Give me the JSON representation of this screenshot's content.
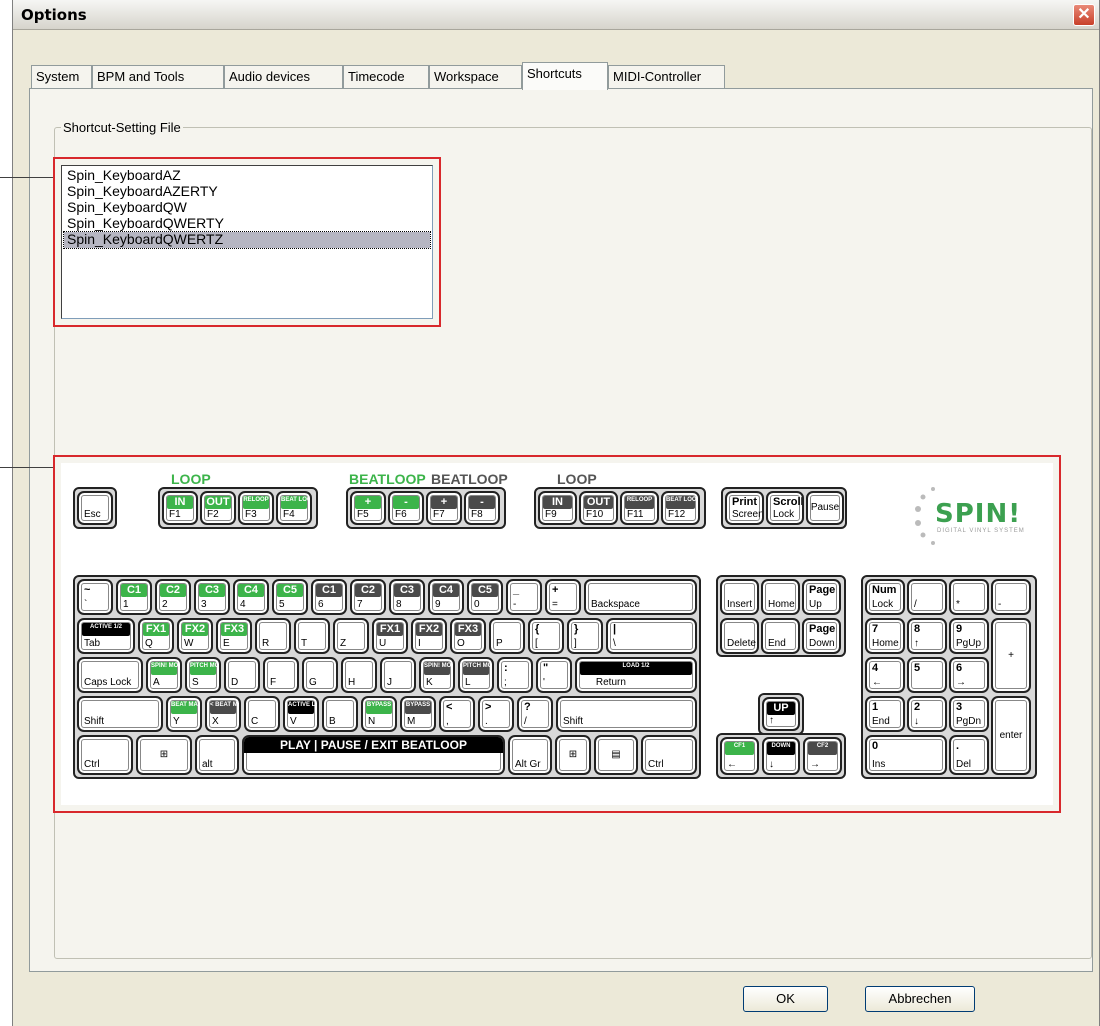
{
  "window": {
    "title": "Options",
    "close": "✕"
  },
  "tabs": [
    "System",
    "BPM and Tools",
    "Audio devices",
    "Timecode",
    "Workspace",
    "Shortcuts",
    "MIDI-Controller"
  ],
  "group_label": "Shortcut-Setting File",
  "shortcut_files": [
    "Spin_KeyboardAZ",
    "Spin_KeyboardAZERTY",
    "Spin_KeyboardQW",
    "Spin_KeyboardQWERTY",
    "Spin_KeyboardQWERTZ"
  ],
  "selected_file": "Spin_KeyboardQWERTZ",
  "keyboard": {
    "labels": {
      "loop1": "LOOP",
      "beatloop1": "BEATLOOP",
      "beatloop2": "BEATLOOP",
      "loop2": "LOOP"
    },
    "logo": {
      "word": "SPIN!",
      "tagline": "DIGITAL VINYL SYSTEM"
    },
    "space_label": "PLAY | PAUSE / EXIT BEATLOOP"
  },
  "buttons": {
    "ok": "OK",
    "cancel": "Abbrechen"
  },
  "colors": {
    "green": "#3cb44a",
    "dark": "#4a4a4a",
    "highlight": "#d8282c"
  }
}
